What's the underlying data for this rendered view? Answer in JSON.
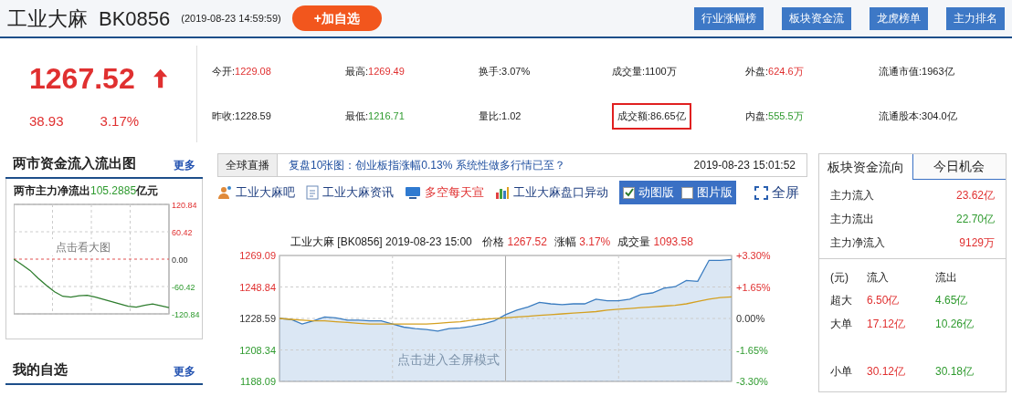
{
  "header": {
    "name": "工业大麻",
    "code": "BK0856",
    "time": "(2019-08-23 14:59:59)",
    "add_button": "+加自选",
    "buttons": [
      "行业涨幅榜",
      "板块资金流",
      "龙虎榜单",
      "主力排名"
    ]
  },
  "quote": {
    "price": "1267.52",
    "change": "38.93",
    "change_pct": "3.17%",
    "items": [
      {
        "label": "今开:",
        "value": "1229.08",
        "color": "#e03030",
        "highlighted": false
      },
      {
        "label": "最高:",
        "value": "1269.49",
        "color": "#e03030",
        "highlighted": false
      },
      {
        "label": "换手:",
        "value": "3.07%",
        "highlighted": false
      },
      {
        "label": "成交量:",
        "value": "1100万",
        "highlighted": false
      },
      {
        "label": "外盘:",
        "value": "624.6万",
        "color": "#e03030",
        "highlighted": false
      },
      {
        "label": "流通市值:",
        "value": "1963亿",
        "highlighted": false
      },
      {
        "label": "昨收:",
        "value": "1228.59",
        "highlighted": false
      },
      {
        "label": "最低:",
        "value": "1216.71",
        "color": "#2e9a2e",
        "highlighted": false
      },
      {
        "label": "量比:",
        "value": "1.02",
        "highlighted": false
      },
      {
        "label": "成交额:",
        "value": "86.65亿",
        "highlighted": true
      },
      {
        "label": "内盘:",
        "value": "555.5万",
        "color": "#2e9a2e",
        "highlighted": false
      },
      {
        "label": "流通股本:",
        "value": "304.0亿",
        "highlighted": false
      }
    ]
  },
  "left_panel": {
    "title": "两市资金流入流出图",
    "more": "更多",
    "subtitle_label": "两市主力净流出",
    "subtitle_value": "105.2885",
    "subtitle_unit": "亿元",
    "hint": "点击看大图",
    "chart_data": {
      "type": "line",
      "grid": true,
      "ref_lines": [
        {
          "axis": "y",
          "value": 0,
          "color": "#e05050"
        }
      ],
      "yticks": [
        {
          "value": 120.84,
          "label": "120.84"
        },
        {
          "value": 60.42,
          "label": "60.42"
        },
        {
          "value": 0,
          "label": "0.00"
        },
        {
          "value": -60.42,
          "label": "-60.42"
        },
        {
          "value": -120.84,
          "label": "-120.84"
        }
      ],
      "ylim": [
        -120.84,
        120.84
      ],
      "series": [
        {
          "color": "#2e7d2e",
          "values": [
            0,
            -12,
            -25,
            -42,
            -58,
            -72,
            -82,
            -84,
            -81,
            -80,
            -84,
            -89,
            -94,
            -99,
            -104,
            -106,
            -102,
            -99,
            -103,
            -107
          ]
        }
      ]
    },
    "watchlist_title": "我的自选",
    "watchlist_more": "更多"
  },
  "center": {
    "news_label": "全球直播",
    "news_headline": "复盘10张图：创业板指涨幅0.13% 系统性做多行情已至？",
    "news_time": "2019-08-23 15:01:52",
    "links": [
      {
        "kind": "person",
        "label": "工业大麻吧"
      },
      {
        "kind": "doc",
        "label": "工业大麻资讯"
      },
      {
        "kind": "screen",
        "label": "多空每天宣"
      },
      {
        "kind": "bars",
        "label": "工业大麻盘口异动"
      }
    ],
    "view_options": [
      {
        "label": "动图版",
        "checked": true
      },
      {
        "label": "图片版",
        "checked": false
      }
    ],
    "fullscreen": "全屏",
    "chart_info": [
      {
        "label": "工业大麻 [BK0856]  2019-08-23 15:00"
      },
      {
        "label": "价格",
        "value": "1267.52"
      },
      {
        "label": "涨幅",
        "value": "3.17%"
      },
      {
        "label": "成交量",
        "value": "1093.58"
      }
    ],
    "right_axis_labels": [
      "+3.30%",
      "+1.65%",
      "0.00%",
      "-1.65%",
      "-3.30%"
    ],
    "hint": "点击进入全屏模式",
    "chart_data": {
      "type": "line",
      "grid": true,
      "ylim": [
        1188.09,
        1269.09
      ],
      "yticks": [
        {
          "value": 1269.09,
          "label": "1269.09"
        },
        {
          "value": 1248.84,
          "label": "1248.84"
        },
        {
          "value": 1228.59,
          "label": "1228.59"
        },
        {
          "value": 1208.34,
          "label": "1208.34"
        },
        {
          "value": 1188.09,
          "label": "1188.09"
        }
      ],
      "series": [
        {
          "type": "area",
          "color": "#3a7cc0",
          "values": [
            1228.6,
            1228,
            1225,
            1227,
            1229.5,
            1229,
            1227.5,
            1227.5,
            1227,
            1227,
            1225,
            1223,
            1222,
            1221.5,
            1220.5,
            1222,
            1222.5,
            1223.5,
            1225,
            1227,
            1231,
            1234,
            1236,
            1239,
            1238,
            1237.5,
            1238,
            1238,
            1241,
            1240,
            1240,
            1241,
            1244,
            1245,
            1248,
            1249,
            1253,
            1252.5,
            1266,
            1266,
            1266.5
          ]
        },
        {
          "type": "line",
          "color": "#d4a020",
          "values": [
            1228.6,
            1228,
            1227.5,
            1227,
            1227,
            1226.5,
            1226,
            1225.5,
            1225,
            1225,
            1225,
            1225,
            1225,
            1225,
            1225.5,
            1226,
            1226.5,
            1227.5,
            1228,
            1228.5,
            1229,
            1229.5,
            1230,
            1230.5,
            1231,
            1231.5,
            1232,
            1232.5,
            1233,
            1234,
            1234.5,
            1235,
            1235.5,
            1236,
            1236.5,
            1237,
            1238,
            1239.5,
            1241,
            1242,
            1242.5
          ]
        }
      ]
    }
  },
  "right_panel": {
    "tabs": [
      {
        "label": "板块资金流向",
        "selected": true
      },
      {
        "label": "今日机会",
        "selected": false
      }
    ],
    "summary": [
      {
        "label": "主力流入",
        "value": "23.62亿",
        "color": "#e03030"
      },
      {
        "label": "主力流出",
        "value": "22.70亿",
        "color": "#2e9a2e"
      },
      {
        "label": "主力净流入",
        "value": "9129万",
        "color": "#e03030"
      }
    ],
    "table_header": [
      "(元)",
      "流入",
      "流出"
    ],
    "table_rows": [
      [
        "超大",
        "6.50亿",
        "4.65亿"
      ],
      [
        "大单",
        "17.12亿",
        "10.26亿"
      ],
      null,
      [
        "小单",
        "30.12亿",
        "30.18亿"
      ]
    ]
  }
}
